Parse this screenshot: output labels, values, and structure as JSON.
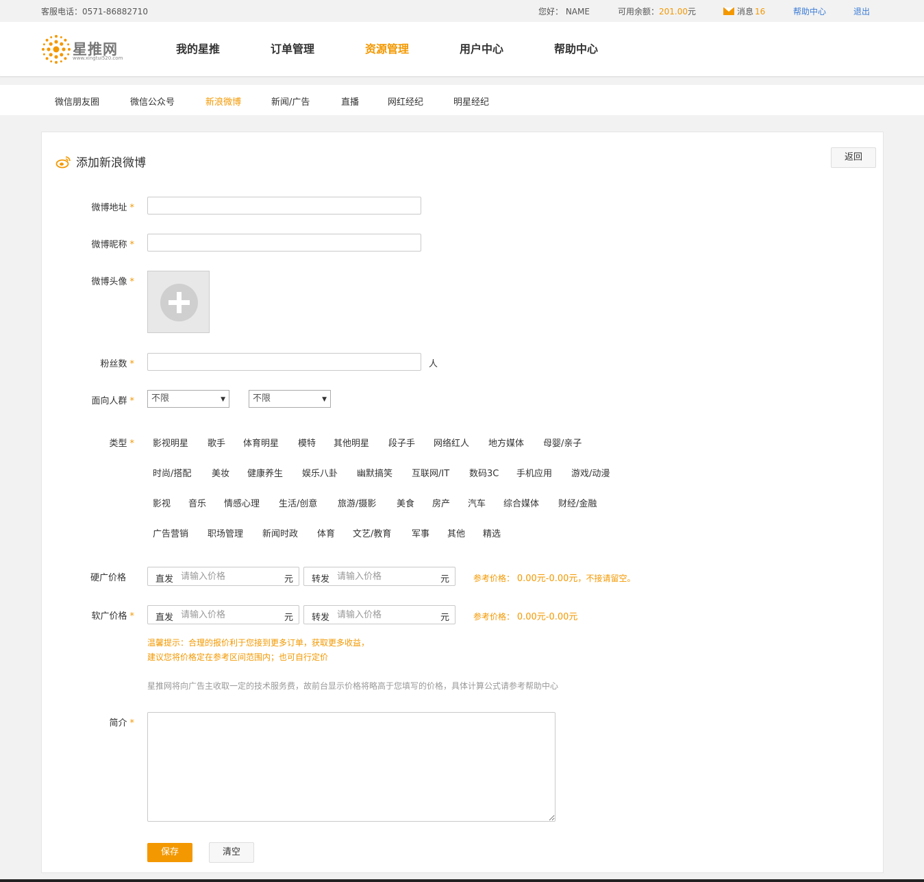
{
  "topbar": {
    "phone": "客服电话：0571-86882710",
    "hello": "您好： NAME",
    "balance_label": "可用余额：",
    "balance_amount": "201.00",
    "balance_unit": "元",
    "messages_label": "消息",
    "messages_count": "16",
    "help": "帮助中心",
    "logout": "退出"
  },
  "logo": {
    "brand": "星推网",
    "url": "www.xingtui520.com"
  },
  "mainnav": [
    "我的星推",
    "订单管理",
    "资源管理",
    "用户中心",
    "帮助中心"
  ],
  "subnav": [
    "微信朋友圈",
    "微信公众号",
    "新浪微博",
    "新闻/广告",
    "直播",
    "网红经纪",
    "明星经纪"
  ],
  "panel": {
    "title": "添加新浪微博",
    "back": "返回"
  },
  "form": {
    "url_label": "微博地址",
    "nickname_label": "微博昵称",
    "avatar_label": "微博头像",
    "fans_label": "粉丝数",
    "fans_unit": "人",
    "audience_label": "面向人群",
    "audience_select1": "不限",
    "audience_select2": "不限",
    "type_label": "类型",
    "type_tags": [
      [
        "影视明星",
        "歌手",
        "体育明星",
        "模特",
        "其他明星",
        "段子手",
        "网络红人",
        "地方媒体",
        "母婴/亲子"
      ],
      [
        "时尚/搭配",
        "美妆",
        "健康养生",
        "娱乐八卦",
        "幽默搞笑",
        "互联网/IT",
        "数码3C",
        "手机应用",
        "游戏/动漫"
      ],
      [
        "影视",
        "音乐",
        "情感心理",
        "生活/创意",
        "旅游/摄影",
        "美食",
        "房产",
        "汽车",
        "综合媒体",
        "财经/金融"
      ],
      [
        "广告营销",
        "职场管理",
        "新闻时政",
        "体育",
        "文艺/教育",
        "军事",
        "其他",
        "精选"
      ]
    ],
    "hard_price_label": "硬广价格",
    "soft_price_label": "软广价格",
    "direct": "直发",
    "repost": "转发",
    "price_placeholder": "请输入价格",
    "yuan": "元",
    "ref_label": "参考价格：",
    "hard_ref_value": "0.00元-0.00元",
    "hard_ref_note": "，不接请留空。",
    "soft_ref_value": "0.00元-0.00元",
    "tip1": "温馨提示：合理的报价利于您接到更多订单，获取更多收益，",
    "tip2": "建议您将价格定在参考区间范围内；也可自行定价",
    "note": "星推网将向广告主收取一定的技术服务费，故前台显示价格将略高于您填写的价格，具体计算公式请参考帮助中心",
    "intro_label": "简介",
    "required_mark": "*",
    "save": "保存",
    "clear": "清空"
  },
  "colors": {
    "accent": "#f39800",
    "link": "#3a7bd5"
  }
}
